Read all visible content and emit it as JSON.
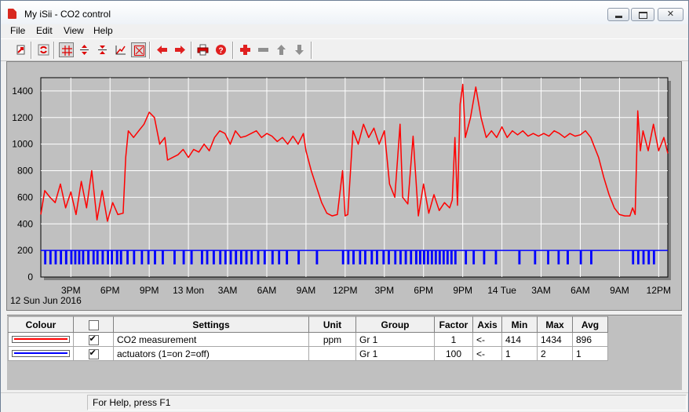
{
  "window": {
    "title": "My iSii - CO2 control"
  },
  "menu": [
    "File",
    "Edit",
    "View",
    "Help"
  ],
  "toolbar": {
    "buttons": [
      "export-icon",
      "refresh-icon",
      "grid-icon",
      "zoom-in-vertical-icon",
      "zoom-out-vertical-icon",
      "cursor-icon",
      "cross-box-icon",
      "arrow-left-icon",
      "arrow-right-icon",
      "print-icon",
      "help-icon",
      "add-icon",
      "remove-icon",
      "move-up-icon",
      "move-down-icon"
    ]
  },
  "chart_data": {
    "type": "line",
    "date_label": "12 Sun Jun 2016",
    "x_ticks": [
      "3PM",
      "6PM",
      "9PM",
      "13 Mon",
      "3AM",
      "6AM",
      "9AM",
      "12PM",
      "3PM",
      "6PM",
      "9PM",
      "14 Tue",
      "3AM",
      "6AM",
      "9AM",
      "12PM"
    ],
    "x_unit": "hours since 12 Jun 2016 12:00",
    "xlim": [
      12.7,
      60.7
    ],
    "ylim": [
      0,
      1500
    ],
    "y_ticks": [
      0,
      200,
      400,
      600,
      800,
      1000,
      1200,
      1400
    ],
    "grid": true,
    "series": [
      {
        "name": "CO2 measurement",
        "color": "#ff0000",
        "points": [
          [
            12.7,
            470
          ],
          [
            13.0,
            650
          ],
          [
            13.4,
            600
          ],
          [
            13.8,
            560
          ],
          [
            14.2,
            700
          ],
          [
            14.6,
            520
          ],
          [
            15.0,
            640
          ],
          [
            15.4,
            470
          ],
          [
            15.8,
            720
          ],
          [
            16.2,
            520
          ],
          [
            16.6,
            800
          ],
          [
            17.0,
            430
          ],
          [
            17.4,
            650
          ],
          [
            17.8,
            420
          ],
          [
            18.2,
            560
          ],
          [
            18.6,
            470
          ],
          [
            19.0,
            480
          ],
          [
            19.2,
            900
          ],
          [
            19.4,
            1100
          ],
          [
            19.8,
            1050
          ],
          [
            20.2,
            1100
          ],
          [
            20.6,
            1150
          ],
          [
            21.0,
            1240
          ],
          [
            21.4,
            1200
          ],
          [
            21.8,
            1000
          ],
          [
            22.2,
            1050
          ],
          [
            22.4,
            880
          ],
          [
            22.8,
            900
          ],
          [
            23.2,
            920
          ],
          [
            23.6,
            960
          ],
          [
            24.0,
            900
          ],
          [
            24.4,
            960
          ],
          [
            24.8,
            940
          ],
          [
            25.2,
            1000
          ],
          [
            25.6,
            950
          ],
          [
            26.0,
            1050
          ],
          [
            26.4,
            1100
          ],
          [
            26.8,
            1080
          ],
          [
            27.2,
            1000
          ],
          [
            27.6,
            1100
          ],
          [
            28.0,
            1050
          ],
          [
            28.4,
            1060
          ],
          [
            28.8,
            1080
          ],
          [
            29.2,
            1100
          ],
          [
            29.6,
            1050
          ],
          [
            30.0,
            1080
          ],
          [
            30.4,
            1060
          ],
          [
            30.8,
            1020
          ],
          [
            31.2,
            1050
          ],
          [
            31.6,
            1000
          ],
          [
            32.0,
            1060
          ],
          [
            32.4,
            1000
          ],
          [
            32.8,
            1080
          ],
          [
            33.0,
            950
          ],
          [
            33.4,
            800
          ],
          [
            33.8,
            680
          ],
          [
            34.2,
            560
          ],
          [
            34.6,
            480
          ],
          [
            35.0,
            460
          ],
          [
            35.4,
            470
          ],
          [
            35.8,
            800
          ],
          [
            36.0,
            460
          ],
          [
            36.2,
            470
          ],
          [
            36.6,
            1100
          ],
          [
            37.0,
            1000
          ],
          [
            37.4,
            1150
          ],
          [
            37.8,
            1050
          ],
          [
            38.2,
            1120
          ],
          [
            38.6,
            1000
          ],
          [
            39.0,
            1100
          ],
          [
            39.4,
            700
          ],
          [
            39.8,
            600
          ],
          [
            40.2,
            1150
          ],
          [
            40.4,
            600
          ],
          [
            40.8,
            550
          ],
          [
            41.2,
            1060
          ],
          [
            41.6,
            460
          ],
          [
            42.0,
            700
          ],
          [
            42.4,
            480
          ],
          [
            42.8,
            620
          ],
          [
            43.2,
            500
          ],
          [
            43.6,
            560
          ],
          [
            44.0,
            520
          ],
          [
            44.2,
            580
          ],
          [
            44.4,
            1050
          ],
          [
            44.6,
            540
          ],
          [
            44.8,
            1300
          ],
          [
            45.0,
            1450
          ],
          [
            45.2,
            1050
          ],
          [
            45.6,
            1200
          ],
          [
            46.0,
            1430
          ],
          [
            46.4,
            1200
          ],
          [
            46.8,
            1050
          ],
          [
            47.2,
            1100
          ],
          [
            47.6,
            1050
          ],
          [
            48.0,
            1130
          ],
          [
            48.4,
            1050
          ],
          [
            48.8,
            1100
          ],
          [
            49.2,
            1070
          ],
          [
            49.6,
            1100
          ],
          [
            50.0,
            1060
          ],
          [
            50.4,
            1080
          ],
          [
            50.8,
            1060
          ],
          [
            51.2,
            1080
          ],
          [
            51.6,
            1060
          ],
          [
            52.0,
            1100
          ],
          [
            52.4,
            1080
          ],
          [
            52.8,
            1050
          ],
          [
            53.2,
            1080
          ],
          [
            53.6,
            1060
          ],
          [
            54.0,
            1070
          ],
          [
            54.4,
            1100
          ],
          [
            54.8,
            1050
          ],
          [
            55.0,
            1000
          ],
          [
            55.4,
            900
          ],
          [
            55.8,
            750
          ],
          [
            56.2,
            620
          ],
          [
            56.6,
            520
          ],
          [
            57.0,
            470
          ],
          [
            57.4,
            460
          ],
          [
            57.8,
            460
          ],
          [
            58.0,
            520
          ],
          [
            58.2,
            470
          ],
          [
            58.4,
            1250
          ],
          [
            58.6,
            950
          ],
          [
            58.8,
            1100
          ],
          [
            59.2,
            950
          ],
          [
            59.6,
            1150
          ],
          [
            60.0,
            950
          ],
          [
            60.4,
            1050
          ],
          [
            60.7,
            930
          ]
        ]
      },
      {
        "name": "actuators (1=on 2=off)",
        "color": "#0000ff",
        "base": 200,
        "drop": 100,
        "drops": [
          13.0,
          13.4,
          13.8,
          14.2,
          14.6,
          15.0,
          15.3,
          15.6,
          15.9,
          16.3,
          16.7,
          17.0,
          17.4,
          17.8,
          18.1,
          18.5,
          18.8,
          19.3,
          19.8,
          20.4,
          20.9,
          21.4,
          22.0,
          22.9,
          23.6,
          24.2,
          25.0,
          25.4,
          25.9,
          26.4,
          26.8,
          27.2,
          27.6,
          28.0,
          28.4,
          28.8,
          29.3,
          29.8,
          30.4,
          30.9,
          31.5,
          32.4,
          33.8,
          35.8,
          36.2,
          36.6,
          37.1,
          37.5,
          38.0,
          38.4,
          38.9,
          39.3,
          39.8,
          40.2,
          40.6,
          41.0,
          41.4,
          41.7,
          42.0,
          42.3,
          42.6,
          42.9,
          43.2,
          43.5,
          43.8,
          44.1,
          44.4,
          45.2,
          45.8,
          46.6,
          47.5,
          49.3,
          50.5,
          51.5,
          52.3,
          53.0,
          54.0,
          54.8,
          58.0,
          58.4,
          58.8,
          59.2,
          59.6
        ]
      }
    ],
    "legend": {
      "headers": [
        "Colour",
        "",
        "Settings",
        "Unit",
        "Group",
        "Factor",
        "Axis",
        "Min",
        "Max",
        "Avg"
      ],
      "rows": [
        {
          "checked": true,
          "color": "#ff0000",
          "settings": "CO2 measurement",
          "unit": "ppm",
          "group": "Gr 1",
          "factor": "1",
          "axis": "<-",
          "min": "414",
          "max": "1434",
          "avg": "896"
        },
        {
          "checked": true,
          "color": "#0000ff",
          "settings": "actuators (1=on 2=off)",
          "unit": "",
          "group": "Gr 1",
          "factor": "100",
          "axis": "<-",
          "min": "1",
          "max": "2",
          "avg": "1"
        }
      ]
    }
  },
  "status": {
    "text": "For Help, press F1"
  }
}
